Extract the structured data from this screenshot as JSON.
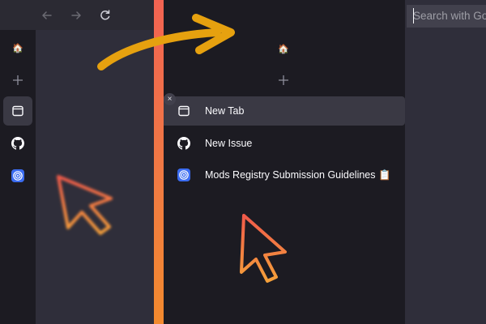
{
  "left_window": {
    "toolbar": {
      "back_icon": "back-arrow-icon",
      "forward_icon": "forward-arrow-icon",
      "reload_icon": "reload-icon"
    },
    "sidebar": {
      "items": [
        {
          "icon": "home-emoji-icon",
          "glyph": "🏠"
        },
        {
          "icon": "plus-icon",
          "glyph": "+"
        },
        {
          "icon": "tab-icon",
          "active": true
        },
        {
          "icon": "github-icon"
        },
        {
          "icon": "target-favicon-icon"
        }
      ]
    }
  },
  "right_panel": {
    "top": {
      "home_glyph": "🏠",
      "new_tab_glyph": "+"
    },
    "tabs": [
      {
        "label": "New Tab",
        "icon": "tab-icon",
        "selected": true
      },
      {
        "label": "New Issue",
        "icon": "github-icon",
        "selected": false
      },
      {
        "label": "Mods Registry Submission Guidelines 📋",
        "icon": "target-favicon-icon",
        "selected": false
      }
    ],
    "close_glyph": "×"
  },
  "url_bar": {
    "placeholder": "Search with Google or enter address"
  },
  "colors": {
    "arrow": "#e6a10f",
    "divider_top": "#f26352",
    "divider_bottom": "#f38a2e",
    "cursor_outline_top": "#f05a4a",
    "cursor_outline_bottom": "#f5a03a",
    "sidebar_bg": "#1c1b22",
    "content_bg": "#2f2e3a",
    "toolbar_bg": "#2b2a33",
    "selected_row_bg": "#3a3944",
    "favicon_blue": "#3b6cf0"
  }
}
